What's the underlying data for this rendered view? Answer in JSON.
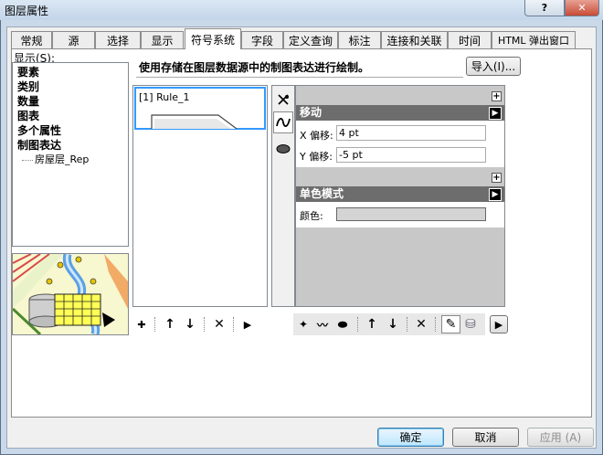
{
  "window": {
    "title": "图层属性",
    "help_label": "?",
    "close_label": "✕"
  },
  "tabs": [
    {
      "label": "常规"
    },
    {
      "label": "源"
    },
    {
      "label": "选择"
    },
    {
      "label": "显示"
    },
    {
      "label": "符号系统",
      "active": true
    },
    {
      "label": "字段"
    },
    {
      "label": "定义查询"
    },
    {
      "label": "标注"
    },
    {
      "label": "连接和关联"
    },
    {
      "label": "时间"
    },
    {
      "label": "HTML 弹出窗口"
    }
  ],
  "show_panel": {
    "label": "显示(S):",
    "items": [
      "要素",
      "类别",
      "数量",
      "图表",
      "多个属性",
      "制图表达"
    ],
    "sub_item": "房屋层_Rep"
  },
  "description": "使用存储在图层数据源中的制图表达进行绘制。",
  "import_label": "导入(I)...",
  "rules": [
    {
      "label": "[1] Rule_1"
    }
  ],
  "layer_toolbar": {
    "icons": [
      "marker-layer-icon",
      "stroke-layer-icon",
      "fill-layer-icon"
    ]
  },
  "properties": {
    "move_section": {
      "title": "移动",
      "x_label": "X 偏移:",
      "x_value": "4 pt",
      "y_label": "Y 偏移:",
      "y_value": "-5 pt"
    },
    "fill_section": {
      "title": "单色模式",
      "color_label": "颜色:",
      "color_value": "#d4d4d4"
    },
    "plus_label": "+",
    "arrow_label": "▶"
  },
  "rules_toolbar": {
    "add": "✚",
    "up": "↑",
    "down": "↓",
    "delete": "✕",
    "more": "▶"
  },
  "props_toolbar": {
    "add_marker": "✦",
    "add_stroke": "〰",
    "add_fill": "⬬",
    "up": "↑",
    "down": "↓",
    "delete": "✕",
    "brush": "✎",
    "db": "⛁",
    "more": "▶"
  },
  "buttons": {
    "ok": "确定",
    "cancel": "取消",
    "apply": "应用 (A)"
  },
  "colors": {
    "accent": "#3399ff",
    "section_header": "#6d6d6d"
  }
}
